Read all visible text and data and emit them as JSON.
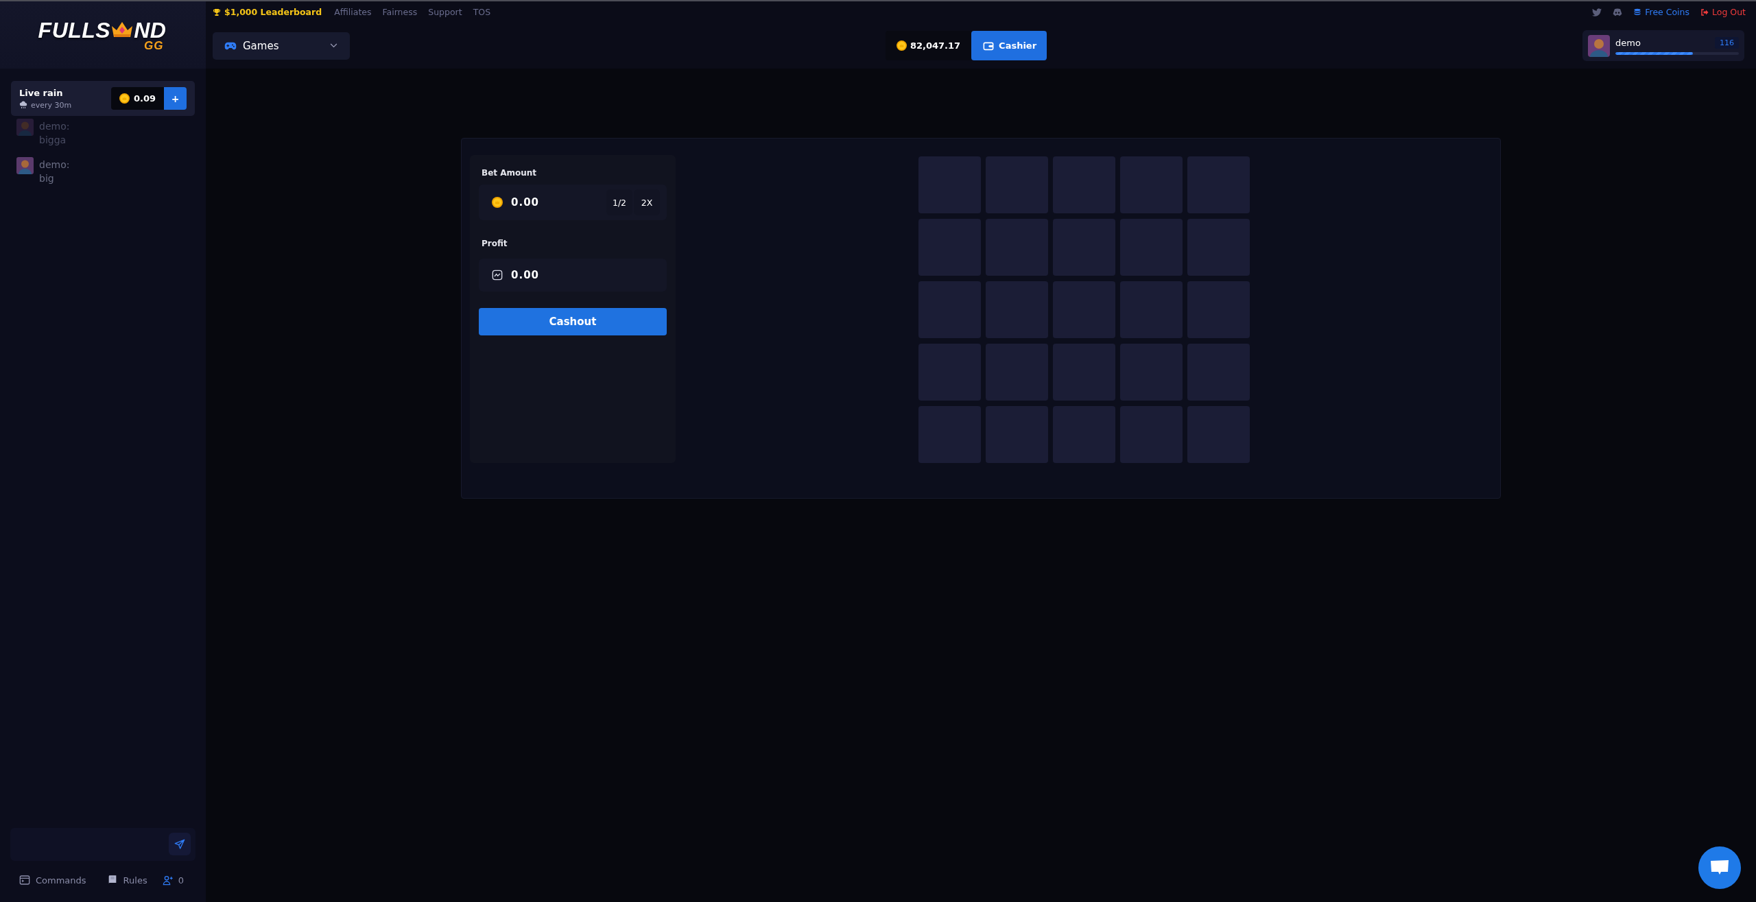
{
  "logo": {
    "start": "FULLS",
    "end": "ND",
    "suffix": "GG"
  },
  "top_nav": {
    "links": [
      {
        "label": "$1,000 Leaderboard",
        "kind": "leaderboard"
      },
      {
        "label": "Affiliates",
        "kind": "plain"
      },
      {
        "label": "Fairness",
        "kind": "plain"
      },
      {
        "label": "Support",
        "kind": "plain"
      },
      {
        "label": "TOS",
        "kind": "plain"
      }
    ],
    "free_coins": "Free Coins",
    "log_out": "Log Out"
  },
  "header": {
    "games_menu": "Games",
    "balance": "82,047.17",
    "cashier": "Cashier",
    "user": {
      "name": "demo",
      "badge": "116",
      "level": 0.63
    }
  },
  "sidebar": {
    "live_rain": {
      "title": "Live rain",
      "interval": "every 30m",
      "amount": "0.09",
      "add_button": "+"
    },
    "chat": [
      {
        "user": "demo:",
        "text": "bigga",
        "faded": true
      },
      {
        "user": "demo:",
        "text": "big",
        "faded": false
      }
    ],
    "footer": {
      "commands": "Commands",
      "rules": "Rules",
      "online": "0"
    }
  },
  "game": {
    "bet_amount": {
      "label": "Bet Amount",
      "value": "0.00",
      "half": "1/2",
      "double": "2X"
    },
    "profit": {
      "label": "Profit",
      "value": "0.00"
    },
    "cashout": "Cashout",
    "grid": [
      {
        "tiles": [
          {
            "revealed": false
          },
          {
            "revealed": false
          },
          {
            "revealed": false
          },
          {
            "revealed": false
          },
          {
            "revealed": false
          }
        ]
      },
      {
        "tiles": [
          {
            "revealed": false
          },
          {
            "revealed": false
          },
          {
            "revealed": false
          },
          {
            "revealed": false
          },
          {
            "revealed": false
          }
        ]
      },
      {
        "tiles": [
          {
            "revealed": false
          },
          {
            "revealed": false
          },
          {
            "revealed": false
          },
          {
            "revealed": false
          },
          {
            "revealed": false
          }
        ]
      },
      {
        "tiles": [
          {
            "revealed": false
          },
          {
            "revealed": false
          },
          {
            "revealed": false
          },
          {
            "revealed": false
          },
          {
            "revealed": false
          }
        ]
      },
      {
        "tiles": [
          {
            "revealed": false
          },
          {
            "revealed": false
          },
          {
            "revealed": false
          },
          {
            "revealed": false
          },
          {
            "revealed": false
          }
        ]
      }
    ]
  }
}
